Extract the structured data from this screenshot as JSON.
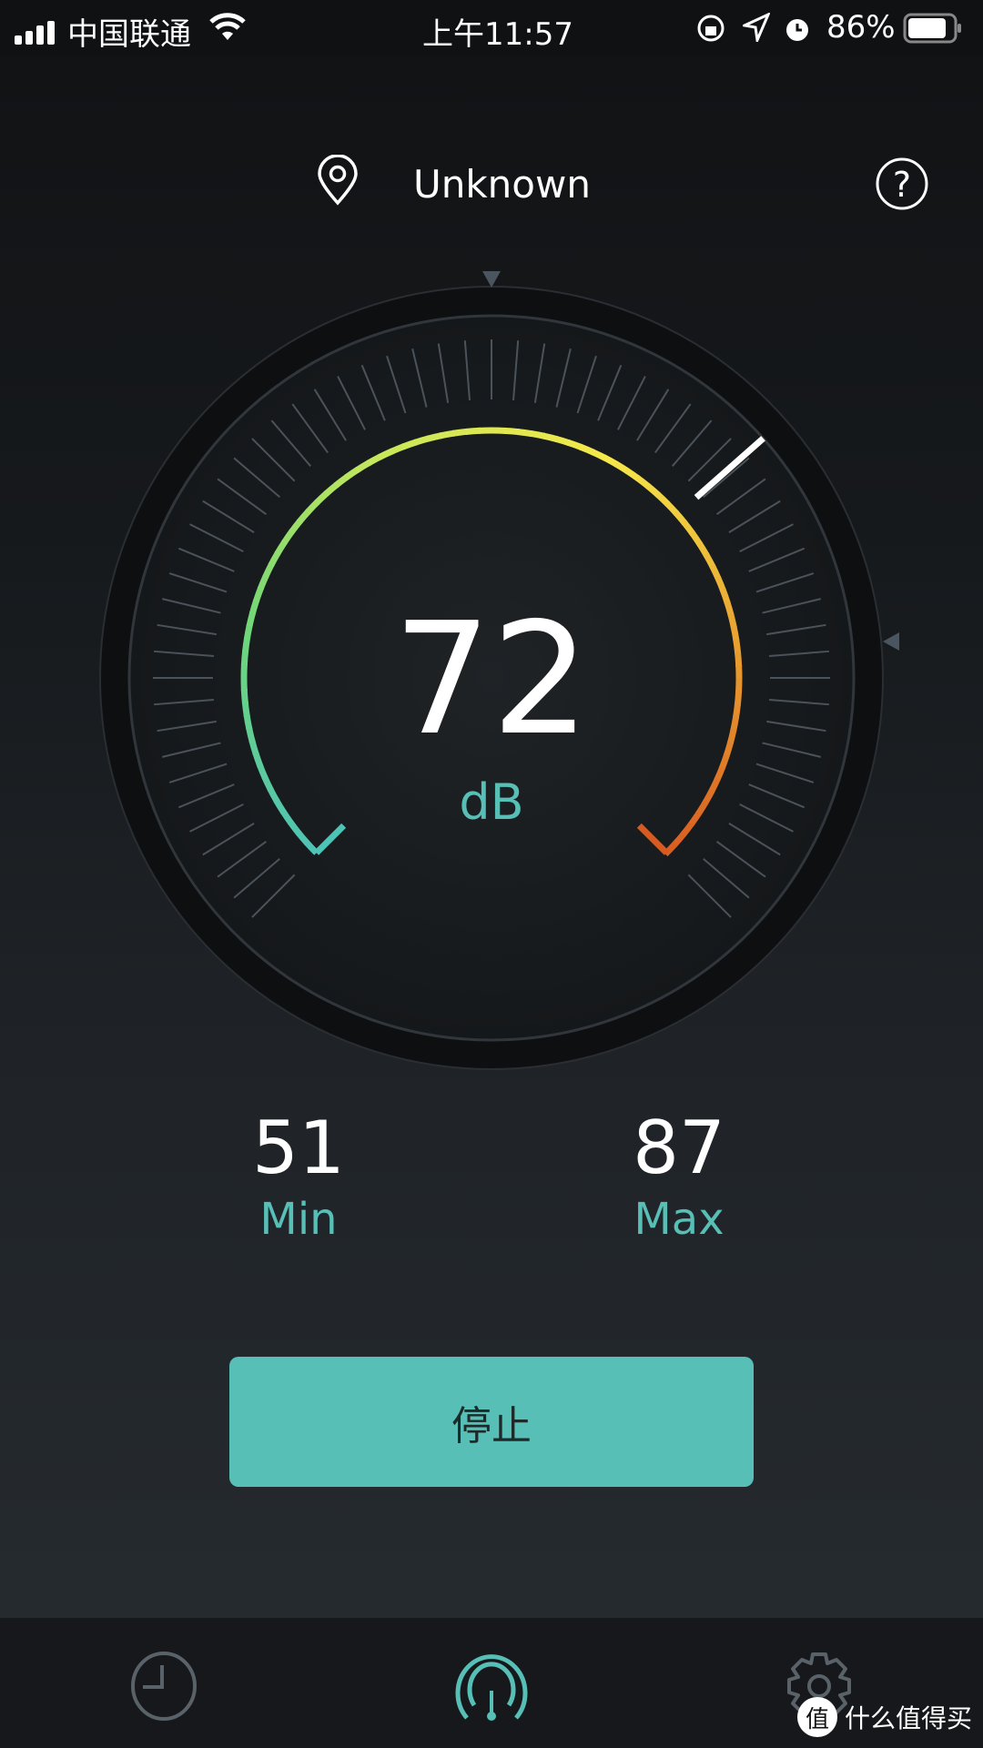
{
  "status_bar": {
    "carrier": "中国联通",
    "time": "上午11:57",
    "battery": "86%",
    "battery_level": 0.86
  },
  "header": {
    "location": "Unknown",
    "help_icon": "question-circle-icon",
    "location_icon": "map-pin-icon"
  },
  "meter": {
    "value": "72",
    "unit": "dB",
    "needle_fraction": 0.68,
    "arc_colors": [
      "#4fc3b5",
      "#6fd67a",
      "#c9e85a",
      "#f5e84a",
      "#e8a030",
      "#d85a20"
    ]
  },
  "stats": {
    "min_value": "51",
    "min_label": "Min",
    "max_value": "87",
    "max_label": "Max"
  },
  "action": {
    "stop_label": "停止",
    "color": "#57bfb6"
  },
  "nav": {
    "items": [
      {
        "icon": "clock-icon",
        "active": false
      },
      {
        "icon": "gauge-icon",
        "active": true
      },
      {
        "icon": "gear-icon",
        "active": false
      }
    ]
  },
  "watermark": {
    "badge": "值",
    "text": "什么值得买"
  }
}
